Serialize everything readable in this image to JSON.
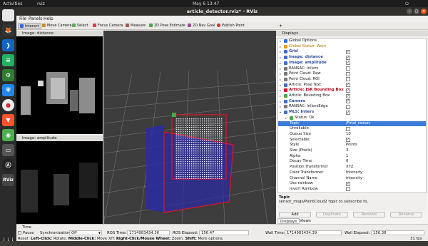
{
  "topbar": {
    "activities": "Activities",
    "app": "rviz",
    "clock": "May 6  13:47"
  },
  "window": {
    "title": "article_detector.rviz* - RViz"
  },
  "menu": {
    "file": "File",
    "panels": "Panels",
    "help": "Help"
  },
  "toolbar": {
    "interact": "Interact",
    "move_camera": "Move Camera",
    "select": "Select",
    "focus_camera": "Focus Camera",
    "measure": "Measure",
    "pose_estimate": "2D Pose Estimate",
    "nav_goal": "2D Nav Goal",
    "publish_point": "Publish Point"
  },
  "image_panels": {
    "distance": "Image: distance",
    "amplitude": "Image: amplitude"
  },
  "displays": {
    "title": "Displays",
    "rows": [
      {
        "label": "Global Options",
        "value": ""
      },
      {
        "label": "Global Status: Warn",
        "value": ""
      },
      {
        "label": "Grid",
        "value": ""
      },
      {
        "label": "Image: distance",
        "value": ""
      },
      {
        "label": "Image: amplitude",
        "value": ""
      },
      {
        "label": "RANSAC: Inliers",
        "value": ""
      },
      {
        "label": "Point Cloud: Raw",
        "value": ""
      },
      {
        "label": "Point Cloud: ROI",
        "value": ""
      },
      {
        "label": "Article: Pose Text",
        "value": ""
      },
      {
        "label": "Article: JSK Bounding Box",
        "value": ""
      },
      {
        "label": "Article: Bounding Box",
        "value": ""
      },
      {
        "label": "Camera",
        "value": ""
      },
      {
        "label": "RANSAC: InliersEdge",
        "value": ""
      },
      {
        "label": "MLS: Inliers",
        "value": ""
      },
      {
        "label": "Status: Ok",
        "value": ""
      },
      {
        "label": "Topic",
        "value": "/Final_ransac"
      },
      {
        "label": "Unreliable",
        "value": ""
      },
      {
        "label": "Queue Size",
        "value": "10"
      },
      {
        "label": "Selectable",
        "value": ""
      },
      {
        "label": "Style",
        "value": "Points"
      },
      {
        "label": "Size (Pixels)",
        "value": "3"
      },
      {
        "label": "Alpha",
        "value": "1"
      },
      {
        "label": "Decay Time",
        "value": "0"
      },
      {
        "label": "Position Transformer",
        "value": "XYZ"
      },
      {
        "label": "Color Transformer",
        "value": "Intensity"
      },
      {
        "label": "Channel Name",
        "value": "intensity"
      },
      {
        "label": "Use rainbow",
        "value": ""
      },
      {
        "label": "Invert Rainbow",
        "value": ""
      }
    ],
    "desc_title": "Topic",
    "desc_text": "sensor_msgs/PointCloud2 topic to subscribe to.",
    "buttons": {
      "add": "Add",
      "duplicate": "Duplicate",
      "remove": "Remove",
      "rename": "Rename"
    },
    "tabs": {
      "displays": "Displays",
      "views": "Views"
    }
  },
  "time": {
    "title": "Time",
    "pause": "Pause",
    "sync_label": "Synchronization:",
    "sync_value": "Off",
    "ros_time_label": "ROS Time:",
    "ros_time": "1714983434.36",
    "ros_elapsed_label": "ROS Elapsed:",
    "ros_elapsed": "156.47",
    "wall_time_label": "Wall Time:",
    "wall_time": "1714983434.39",
    "wall_elapsed_label": "Wall Elapsed:",
    "wall_elapsed": "156.38"
  },
  "status": {
    "reset": "Reset",
    "hint_html_parts": [
      "Left-Click:",
      " Rotate. ",
      "Middle-Click:",
      " Move X/Y. ",
      "Right-Click/Mouse Wheel:",
      " Zoom. ",
      "Shift:",
      " More options."
    ],
    "fps": "31 fps"
  },
  "colors": {
    "accent": "#3b7bd9",
    "bbox_red": "#e0142a",
    "plane_blue": "#2a2aa6"
  }
}
